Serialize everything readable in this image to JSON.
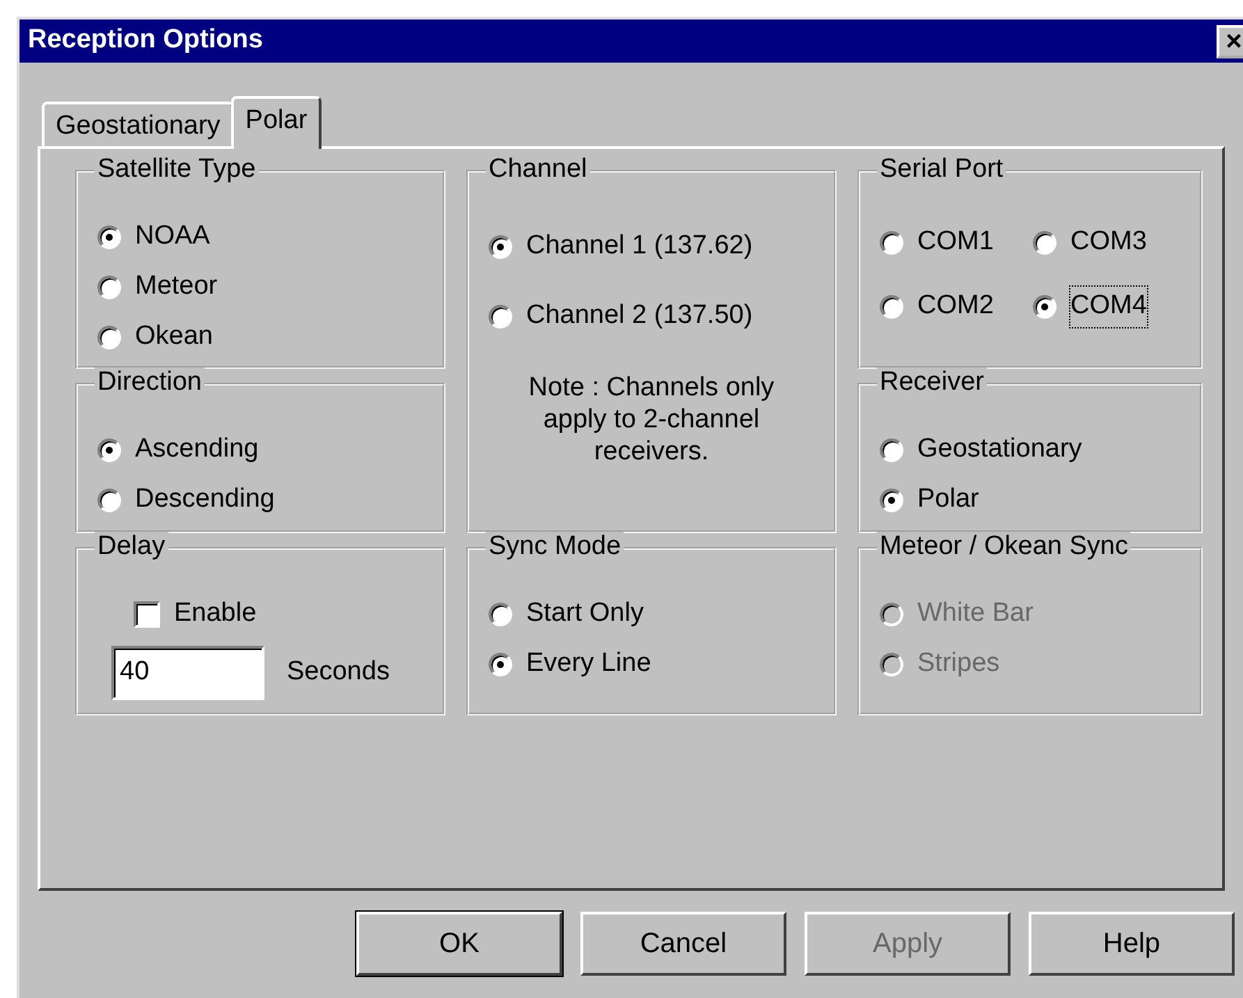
{
  "window": {
    "title": "Reception Options",
    "close": "×"
  },
  "tabs": [
    {
      "label": "Geostationary",
      "selected": false
    },
    {
      "label": "Polar",
      "selected": true
    }
  ],
  "groups": [
    {
      "title": "Satellite Type",
      "kind": "radios",
      "options": [
        {
          "label": "NOAA",
          "selected": true,
          "disabled": false
        },
        {
          "label": "Meteor",
          "selected": false,
          "disabled": false
        },
        {
          "label": "Okean",
          "selected": false,
          "disabled": false
        }
      ]
    },
    {
      "title": "Channel",
      "kind": "note",
      "options": [
        {
          "label": "Channel 1 (137.62)",
          "selected": true,
          "disabled": false
        },
        {
          "label": "Channel 2 (137.50)",
          "selected": false,
          "disabled": false
        }
      ],
      "note": "Note : Channels only apply to 2-channel receivers."
    },
    {
      "title": "Serial Port",
      "kind": "grid",
      "options": [
        {
          "label": "COM1",
          "selected": false,
          "disabled": false
        },
        {
          "label": "COM3",
          "selected": false,
          "disabled": false
        },
        {
          "label": "COM2",
          "selected": false,
          "disabled": false
        },
        {
          "label": "COM4",
          "selected": true,
          "disabled": false,
          "focused": true
        }
      ]
    },
    {
      "title": "Direction",
      "kind": "radios",
      "options": [
        {
          "label": "Ascending",
          "selected": true,
          "disabled": false
        },
        {
          "label": "Descending",
          "selected": false,
          "disabled": false
        }
      ]
    },
    {
      "title": "Receiver",
      "kind": "radios",
      "options": [
        {
          "label": "Geostationary",
          "selected": false,
          "disabled": false
        },
        {
          "label": "Polar",
          "selected": true,
          "disabled": false
        }
      ]
    },
    {
      "title": "Delay",
      "kind": "delay",
      "checkbox": {
        "label": "Enable",
        "checked": false
      },
      "field": {
        "value": "40"
      },
      "unit": "Seconds"
    },
    {
      "title": "Sync Mode",
      "kind": "radios",
      "options": [
        {
          "label": "Start Only",
          "selected": false,
          "disabled": false
        },
        {
          "label": "Every Line",
          "selected": true,
          "disabled": false
        }
      ]
    },
    {
      "title": "Meteor / Okean Sync",
      "kind": "radios",
      "options": [
        {
          "label": "White Bar",
          "selected": false,
          "disabled": true
        },
        {
          "label": "Stripes",
          "selected": false,
          "disabled": true
        }
      ]
    }
  ],
  "buttons": [
    {
      "label": "OK",
      "default": true,
      "disabled": false
    },
    {
      "label": "Cancel",
      "default": false,
      "disabled": false
    },
    {
      "label": "Apply",
      "default": false,
      "disabled": true
    },
    {
      "label": "Help",
      "default": false,
      "disabled": false
    }
  ]
}
